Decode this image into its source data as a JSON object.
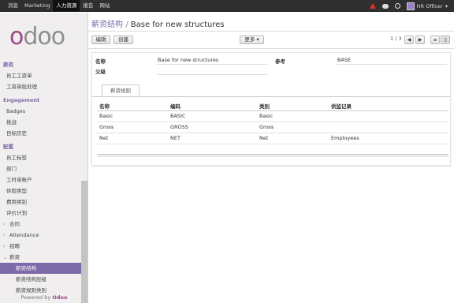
{
  "topbar": {
    "menu": [
      "消息",
      "Marketing",
      "人力资源",
      "报告",
      "网站"
    ],
    "user": "HR Officer"
  },
  "sidebar": {
    "logo": "odoo",
    "sections": {
      "salary": "薪资",
      "engagement": "Engagement",
      "config": "配置"
    },
    "items": {
      "employee_payslips": "员工工资单",
      "payslip_batches": "工资单批处理",
      "badges": "Badges",
      "challenges": "挑战",
      "goals_history": "目标历史",
      "employee_tags": "员工标签",
      "departments": "部门",
      "timesheet_accounts": "工时单账户",
      "leave_types": "休假类型",
      "expense_types": "费用类别",
      "appraisal_plans": "评价计划",
      "contracts": "合同",
      "attendance": "Attendance",
      "recruitment": "招聘",
      "payroll": "薪资",
      "salary_structures": "薪资结构",
      "salary_structure_hierarchy": "薪资结构层级",
      "salary_rule_categories": "薪资规则类别"
    },
    "powered_by": "Powered by",
    "powered_brand": "Odoo"
  },
  "header": {
    "breadcrumb_parent": "薪资结构",
    "breadcrumb_sep": "/",
    "breadcrumb_current": "Base for new structures",
    "edit_label": "编辑",
    "create_label": "创建",
    "more_label": "更多 ▾",
    "pager": "1 / 3"
  },
  "form": {
    "name_label": "名称",
    "name_value": "Base for new structures",
    "parent_label": "父级",
    "ref_label": "参考",
    "ref_value": "BASE",
    "tab_label": "薪资规则",
    "columns": [
      "名称",
      "编码",
      "类别",
      "供监记录"
    ],
    "rows": [
      [
        "Basic",
        "BASIC",
        "Basic",
        ""
      ],
      [
        "Gross",
        "GROSS",
        "Gross",
        ""
      ],
      [
        "Net",
        "NET",
        "Net",
        "Employees"
      ]
    ]
  }
}
